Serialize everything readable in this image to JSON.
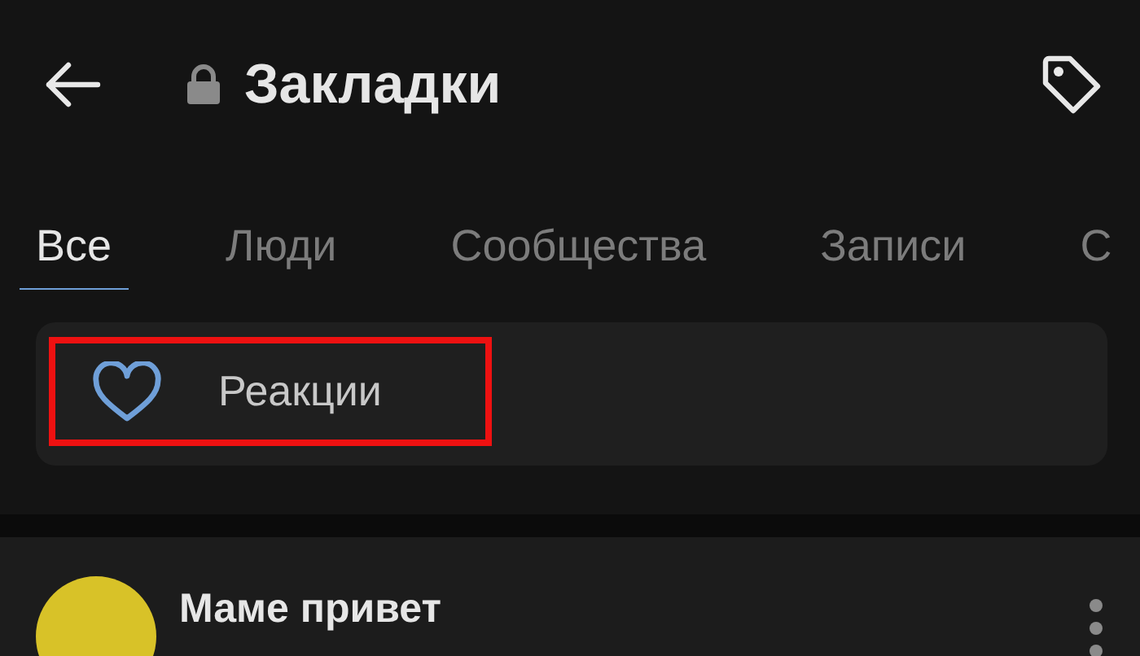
{
  "header": {
    "title": "Закладки",
    "locked": true
  },
  "tabs": [
    {
      "label": "Все",
      "selected": true
    },
    {
      "label": "Люди",
      "selected": false
    },
    {
      "label": "Сообщества",
      "selected": false
    },
    {
      "label": "Записи",
      "selected": false
    },
    {
      "label": "С",
      "selected": false
    }
  ],
  "filter": {
    "label": "Реакции",
    "highlighted": true
  },
  "post": {
    "author": "Маме привет"
  }
}
